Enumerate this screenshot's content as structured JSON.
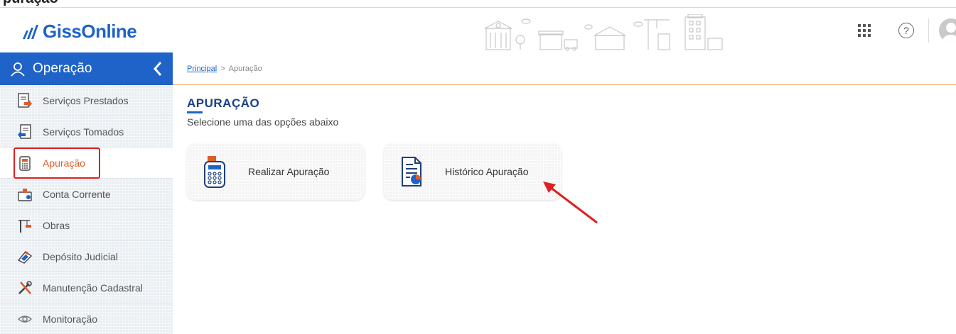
{
  "top_heading": "puração",
  "header": {
    "logo_text": "GissOnline",
    "apps_icon": "apps-grid-icon",
    "help_glyph": "?",
    "avatar_icon": "user-avatar-icon"
  },
  "sidebar": {
    "title": "Operação",
    "items": [
      {
        "label": "Serviços Prestados",
        "icon": "document-out-icon"
      },
      {
        "label": "Serviços Tomados",
        "icon": "document-in-icon"
      },
      {
        "label": "Apuração",
        "icon": "calculator-icon",
        "active": true
      },
      {
        "label": "Conta Corrente",
        "icon": "wallet-icon"
      },
      {
        "label": "Obras",
        "icon": "crane-icon"
      },
      {
        "label": "Depósito Judicial",
        "icon": "deposit-icon"
      },
      {
        "label": "Manutenção Cadastral",
        "icon": "tools-icon"
      },
      {
        "label": "Monitoração",
        "icon": "eye-icon"
      }
    ]
  },
  "breadcrumb": {
    "home": "Principal",
    "separator": ">",
    "current": "Apuração"
  },
  "main": {
    "title": "APURAÇÃO",
    "subtitle": "Selecione uma das opções abaixo",
    "cards": [
      {
        "label": "Realizar Apuração",
        "icon": "calculator-icon"
      },
      {
        "label": "Histórico Apuração",
        "icon": "report-chart-icon"
      }
    ]
  },
  "colors": {
    "brand_blue": "#1f63c8",
    "active_orange": "#e05b2a",
    "annotation_red": "#e02020"
  }
}
